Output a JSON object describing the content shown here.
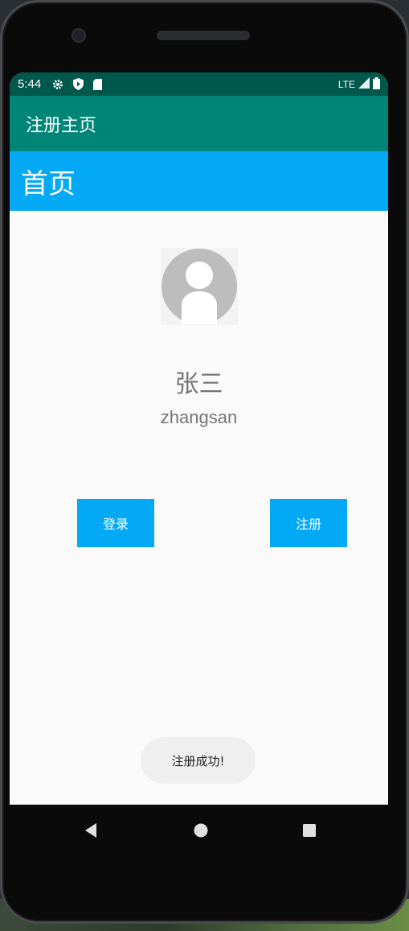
{
  "status_bar": {
    "time": "5:44",
    "network": "LTE",
    "icons": [
      "gear-icon",
      "shield-play-icon",
      "sd-card-icon",
      "signal-icon",
      "battery-icon"
    ]
  },
  "app_bar": {
    "title": "注册主页"
  },
  "page_header": {
    "title": "首页"
  },
  "profile": {
    "name": "张三",
    "username": "zhangsan",
    "avatar_icon": "default-avatar-icon"
  },
  "actions": {
    "login_label": "登录",
    "register_label": "注册"
  },
  "toast": {
    "message": "注册成功!"
  },
  "nav_bar": {
    "icons": [
      "back-icon",
      "home-icon",
      "recents-icon"
    ]
  },
  "colors": {
    "status_bar": "#00574b",
    "app_bar": "#008577",
    "accent": "#03a9f4",
    "text_secondary": "#757575",
    "background": "#fafafa"
  }
}
